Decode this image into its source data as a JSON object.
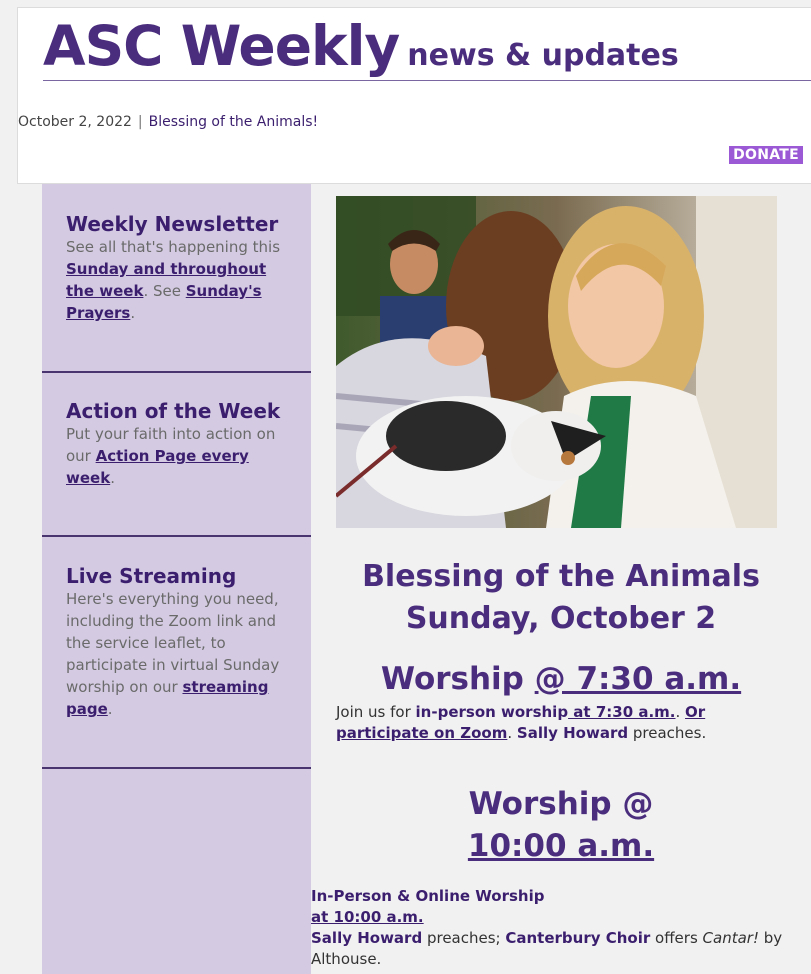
{
  "header": {
    "title": "ASC Weekly",
    "subtitle": "news & updates",
    "date": "October 2, 2022",
    "separator": "|",
    "subject": "Blessing of the Animals!",
    "donate_label": "DONATE"
  },
  "sidebar": {
    "sections": [
      {
        "heading": "Weekly Newsletter",
        "text_1": "See all that's happening this",
        "link_1": "Sunday and throughout the week",
        "text_2": ". See ",
        "link_2": "Sunday's Prayers",
        "text_3": "."
      },
      {
        "heading": "Action of the Week",
        "text_1": "Put your faith into action on our ",
        "link_1": "Action Page every week",
        "text_2": "."
      },
      {
        "heading": "Live Streaming",
        "text_1": "Here's everything you need, including the Zoom link and the service leaflet, to participate in virtual Sunday worship on our ",
        "link_1": "streaming page",
        "text_2": "."
      }
    ]
  },
  "main": {
    "event_title": "Blessing of the Animals",
    "event_date": "Sunday, October 2",
    "worship1": {
      "prefix": "Worship ",
      "link": "@ 7:30 a.m.",
      "text_1": "Join us for ",
      "bold_1": "in-person worship",
      "link_1": " at 7:30 a.m.",
      "link_2": "Or participate on Zoom",
      "text_2": ". ",
      "bold_2": "Sally Howard",
      "text_3": " preaches."
    },
    "worship2": {
      "line1": "Worship @",
      "link": "10:00 a.m.",
      "bold_1": "In-Person & Online Worship",
      "link_1": "at 10:00 a.m.",
      "bold_2": "Sally Howard",
      "text_1": " preaches; ",
      "bold_3": "Canterbury Choir",
      "text_2": " offers ",
      "italic_1": "Cantar!",
      "text_3": " by Althouse."
    }
  },
  "colors": {
    "brand_purple": "#4a2d7d",
    "sidebar_bg": "#d4cbe2",
    "donate_bg": "#9b59d6"
  }
}
